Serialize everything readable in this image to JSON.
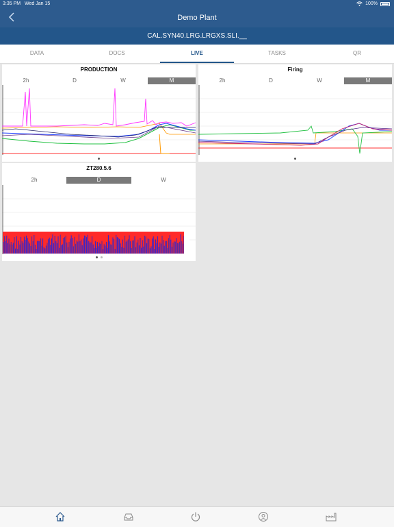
{
  "status": {
    "time": "3:35 PM",
    "date": "Wed Jan 15",
    "battery": "100%"
  },
  "nav": {
    "title": "Demo Plant",
    "subtitle": "CAL.SYN40.LRG.LRGXS.SLI.__"
  },
  "tabs": [
    {
      "label": "DATA",
      "active": false
    },
    {
      "label": "DOCS",
      "active": false
    },
    {
      "label": "LIVE",
      "active": true
    },
    {
      "label": "TASKS",
      "active": false
    },
    {
      "label": "QR",
      "active": false
    }
  ],
  "cards": [
    {
      "title": "PRODUCTION",
      "ranges": [
        "2h",
        "D",
        "W",
        "M"
      ],
      "selected": "M"
    },
    {
      "title": "Firing",
      "ranges": [
        "2h",
        "D",
        "W",
        "M"
      ],
      "selected": "M"
    },
    {
      "title": "ZT280.5.6",
      "ranges": [
        "2h",
        "D",
        "W"
      ],
      "selected": "D"
    }
  ],
  "bottom_tabs": [
    "home-icon",
    "inbox-icon",
    "power-icon",
    "profile-icon",
    "factory-icon"
  ],
  "colors": {
    "primary": "#2d5b8e",
    "subbar": "#23568a",
    "selected_segment": "#7a7a7a"
  }
}
